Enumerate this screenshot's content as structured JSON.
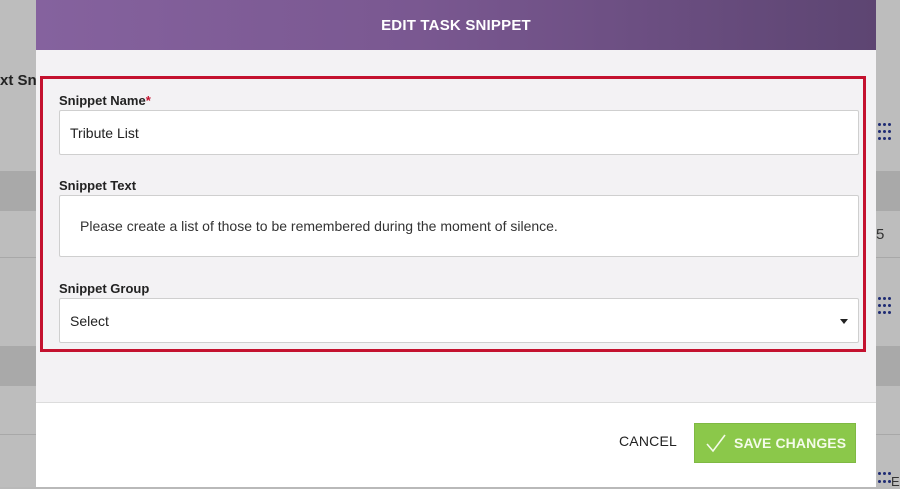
{
  "background": {
    "partial_heading": "xt Sn",
    "partial_number": "5",
    "partial_text": "E"
  },
  "modal": {
    "title": "EDIT TASK SNIPPET",
    "fields": {
      "name": {
        "label": "Snippet Name",
        "required_mark": "*",
        "value": "Tribute List"
      },
      "text": {
        "label": "Snippet Text",
        "value": "Please create a list of those to be remembered during the moment of silence."
      },
      "group": {
        "label": "Snippet Group",
        "selected": "Select"
      }
    },
    "footer": {
      "cancel_label": "CANCEL",
      "save_label": "SAVE CHANGES"
    }
  },
  "colors": {
    "header_start": "#85629e",
    "header_end": "#5d4572",
    "highlight_border": "#c4122f",
    "save_button": "#8bc84a"
  },
  "icons": [
    "grid-dots-icon",
    "check-icon",
    "caret-down-icon"
  ]
}
